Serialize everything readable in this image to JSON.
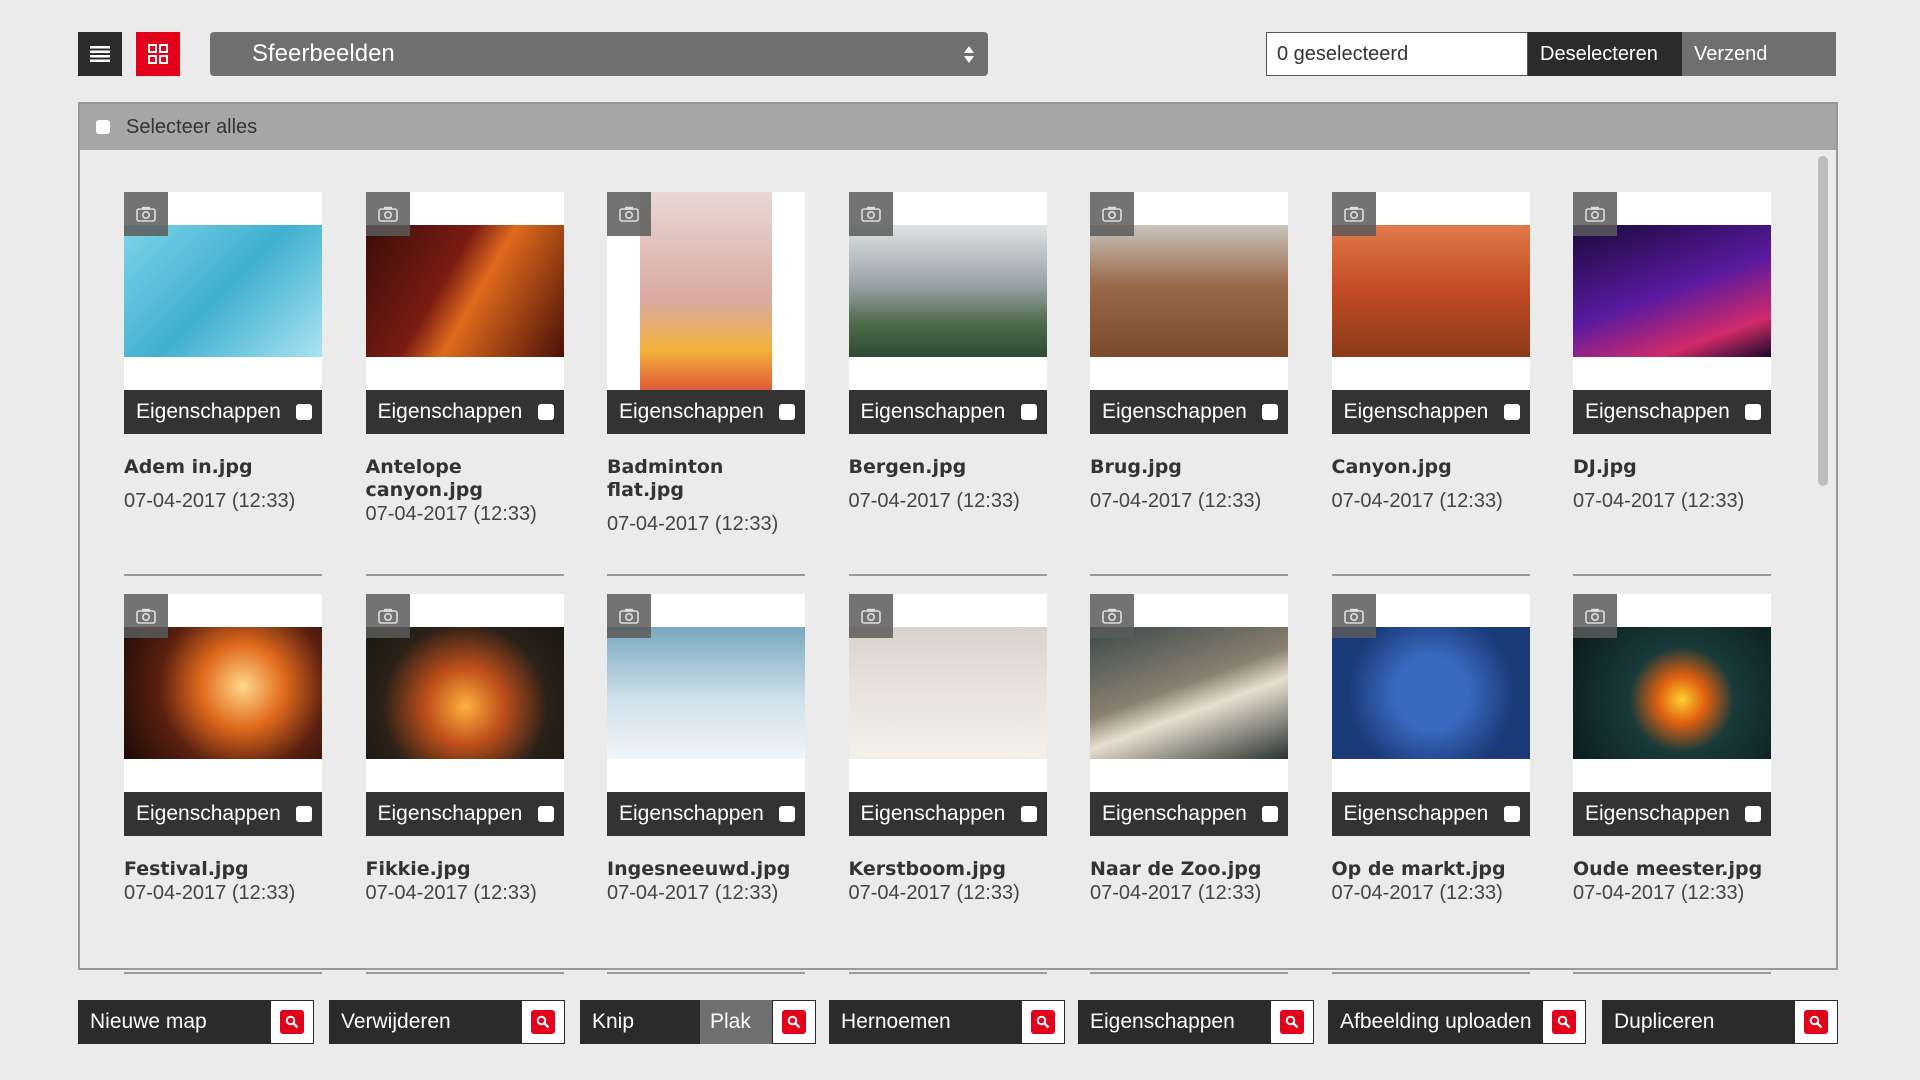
{
  "toolbar": {
    "folder": "Sfeerbeelden",
    "selected_count": "0 geselecteerd",
    "deselect": "Deselecteren",
    "send": "Verzend"
  },
  "panel": {
    "select_all": "Selecteer alles"
  },
  "tile_props_label": "Eigenschappen",
  "files": [
    {
      "name": "Adem in.jpg",
      "date": "07-04-2017 (12:33)",
      "icon": "swimmer-photo"
    },
    {
      "name": "Antelope canyon.jpg",
      "date": "07-04-2017 (12:33)",
      "icon": "canyon-photo"
    },
    {
      "name": "Badminton flat.jpg",
      "date": "07-04-2017 (12:33)",
      "icon": "building-photo"
    },
    {
      "name": "Bergen.jpg",
      "date": "07-04-2017 (12:33)",
      "icon": "mountain-photo"
    },
    {
      "name": "Brug.jpg",
      "date": "07-04-2017 (12:33)",
      "icon": "bridge-photo"
    },
    {
      "name": "Canyon.jpg",
      "date": "07-04-2017 (12:33)",
      "icon": "canyon-photo"
    },
    {
      "name": "DJ.jpg",
      "date": "07-04-2017 (12:33)",
      "icon": "dj-photo"
    },
    {
      "name": "Festival.jpg",
      "date": "07-04-2017 (12:33)",
      "icon": "festival-photo"
    },
    {
      "name": "Fikkie.jpg",
      "date": "07-04-2017 (12:33)",
      "icon": "fire-photo"
    },
    {
      "name": "Ingesneeuwd.jpg",
      "date": "07-04-2017 (12:33)",
      "icon": "snow-photo"
    },
    {
      "name": "Kerstboom.jpg",
      "date": "07-04-2017 (12:33)",
      "icon": "tree-photo"
    },
    {
      "name": "Naar de Zoo.jpg",
      "date": "07-04-2017 (12:33)",
      "icon": "polar-bear-photo"
    },
    {
      "name": "Op de markt.jpg",
      "date": "07-04-2017 (12:33)",
      "icon": "blueberries-photo"
    },
    {
      "name": "Oude meester.jpg",
      "date": "07-04-2017 (12:33)",
      "icon": "lanterns-photo"
    }
  ],
  "bottom": {
    "new_folder": "Nieuwe map",
    "delete": "Verwijderen",
    "cut": "Knip",
    "paste": "Plak",
    "rename": "Hernoemen",
    "properties": "Eigenschappen",
    "upload": "Afbeelding uploaden",
    "duplicate": "Dupliceren"
  },
  "colors": {
    "accent": "#e3001b",
    "dark": "#2b2b2b",
    "mid": "#6f6f6f"
  }
}
